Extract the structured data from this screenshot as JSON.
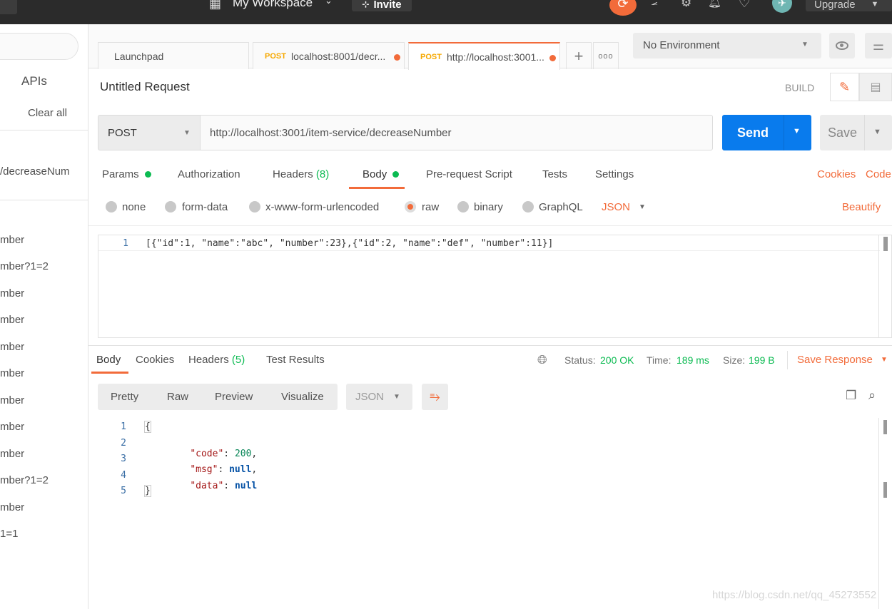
{
  "topbar": {
    "workspace": "My Workspace",
    "invite": "Invite",
    "upgrade": "Upgrade"
  },
  "sidebar": {
    "apis": "APIs",
    "clear_all": "Clear all",
    "items": [
      "/decreaseNum",
      "mber",
      "mber?1=2",
      "mber",
      "mber",
      "mber",
      "mber",
      "mber",
      "mber",
      "mber",
      "mber?1=2",
      "mber",
      "1=1"
    ]
  },
  "tabs": [
    {
      "label": "Launchpad",
      "method": ""
    },
    {
      "label": "localhost:8001/decr...",
      "method": "POST"
    },
    {
      "label": "http://localhost:3001...",
      "method": "POST"
    }
  ],
  "environment": {
    "selected": "No Environment"
  },
  "request": {
    "title": "Untitled Request",
    "build": "BUILD",
    "method": "POST",
    "url": "http://localhost:3001/item-service/decreaseNumber",
    "send": "Send",
    "save": "Save"
  },
  "request_tabs": {
    "params": "Params",
    "authorization": "Authorization",
    "headers": "Headers",
    "headers_count": "(8)",
    "body": "Body",
    "prerequest": "Pre-request Script",
    "tests": "Tests",
    "settings": "Settings",
    "cookies": "Cookies",
    "code": "Code"
  },
  "body_types": {
    "none": "none",
    "form_data": "form-data",
    "urlencoded": "x-www-form-urlencoded",
    "raw": "raw",
    "binary": "binary",
    "graphql": "GraphQL",
    "format": "JSON",
    "beautify": "Beautify"
  },
  "request_body": {
    "line_number": "1",
    "text": "[{\"id\":1, \"name\":\"abc\", \"number\":23},{\"id\":2, \"name\":\"def\", \"number\":11}]"
  },
  "response_tabs": {
    "body": "Body",
    "cookies": "Cookies",
    "headers": "Headers",
    "headers_count": "(5)",
    "test_results": "Test Results"
  },
  "response_meta": {
    "status_label": "Status:",
    "status_value": "200 OK",
    "time_label": "Time:",
    "time_value": "189 ms",
    "size_label": "Size:",
    "size_value": "199 B",
    "save_response": "Save Response"
  },
  "view_modes": {
    "pretty": "Pretty",
    "raw": "Raw",
    "preview": "Preview",
    "visualize": "Visualize",
    "format": "JSON"
  },
  "response_body": {
    "line_numbers": [
      "1",
      "2",
      "3",
      "4",
      "5"
    ],
    "open_brace": "{",
    "close_brace": "}",
    "code_key": "\"code\"",
    "code_value": "200",
    "msg_key": "\"msg\"",
    "msg_value": "null",
    "data_key": "\"data\"",
    "data_value": "null"
  },
  "watermark": "https://blog.csdn.net/qq_45273552",
  "colors": {
    "accent": "#f26b3a",
    "send_blue": "#097bed",
    "status_green": "#0cbb52"
  }
}
